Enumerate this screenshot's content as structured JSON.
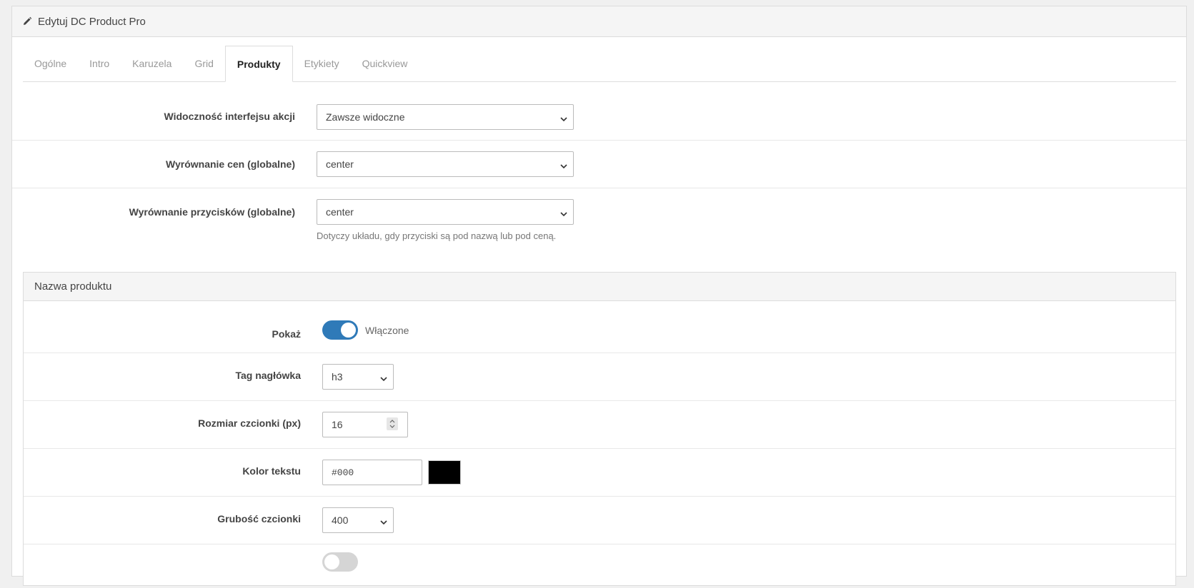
{
  "header": {
    "title": "Edytuj DC Product Pro",
    "icon": "pencil-icon"
  },
  "tabs": [
    {
      "label": "Ogólne",
      "active": false
    },
    {
      "label": "Intro",
      "active": false
    },
    {
      "label": "Karuzela",
      "active": false
    },
    {
      "label": "Grid",
      "active": false
    },
    {
      "label": "Produkty",
      "active": true
    },
    {
      "label": "Etykiety",
      "active": false
    },
    {
      "label": "Quickview",
      "active": false
    }
  ],
  "form": {
    "action_visibility": {
      "label": "Widoczność interfejsu akcji",
      "value": "Zawsze widoczne"
    },
    "price_align": {
      "label": "Wyrównanie cen (globalne)",
      "value": "center"
    },
    "button_align": {
      "label": "Wyrównanie przycisków (globalne)",
      "value": "center",
      "help": "Dotyczy układu, gdy przyciski są pod nazwą lub pod ceną."
    }
  },
  "product_name": {
    "heading": "Nazwa produktu",
    "show": {
      "label": "Pokaż",
      "state_text": "Włączone",
      "enabled": true
    },
    "heading_tag": {
      "label": "Tag nagłówka",
      "value": "h3"
    },
    "font_size": {
      "label": "Rozmiar czcionki (px)",
      "value": "16"
    },
    "text_color": {
      "label": "Kolor tekstu",
      "value": "#000",
      "swatch": "#000000"
    },
    "font_weight": {
      "label": "Grubość czcionki",
      "value": "400"
    }
  },
  "colors": {
    "accent": "#2f7ab8",
    "panel_bg": "#f5f5f5"
  }
}
